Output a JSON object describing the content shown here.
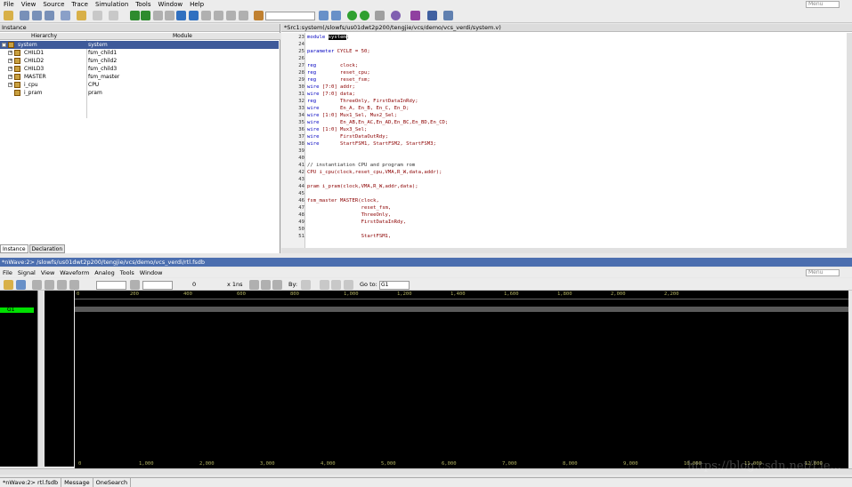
{
  "menubar": {
    "items": [
      "File",
      "View",
      "Source",
      "Trace",
      "Simulation",
      "Tools",
      "Window",
      "Help"
    ],
    "search_placeholder": "Menu"
  },
  "instance_panel": {
    "title": "Instance",
    "columns": [
      "Hierarchy",
      "Module"
    ],
    "rows": [
      {
        "name": "system",
        "module": "system",
        "selected": true
      },
      {
        "name": "CHILD1",
        "module": "fsm_child1"
      },
      {
        "name": "CHILD2",
        "module": "fsm_child2"
      },
      {
        "name": "CHILD3",
        "module": "fsm_child3"
      },
      {
        "name": "MASTER",
        "module": "fsm_master"
      },
      {
        "name": "i_cpu",
        "module": "CPU"
      },
      {
        "name": "i_pram",
        "module": "pram"
      }
    ],
    "tabs": [
      "Instance",
      "Declaration"
    ]
  },
  "source_panel": {
    "title": "*Src1:system(/slowfs/us01dwt2p200/tengjie/vcs/demo/vcs_verdi/system.v)",
    "lines": [
      {
        "n": "23",
        "t": "module system;"
      },
      {
        "n": "24",
        "t": ""
      },
      {
        "n": "25",
        "t": "parameter CYCLE = 50;"
      },
      {
        "n": "26",
        "t": ""
      },
      {
        "n": "27",
        "t": "reg        clock;"
      },
      {
        "n": "28",
        "t": "reg        reset_cpu;"
      },
      {
        "n": "29",
        "t": "reg        reset_fsm;"
      },
      {
        "n": "30",
        "t": "wire [7:0] addr;"
      },
      {
        "n": "31",
        "t": "wire [7:0] data;"
      },
      {
        "n": "32",
        "t": "reg        ThreeOnly, FirstDataInRdy;"
      },
      {
        "n": "33",
        "t": "wire       En_A, En_B, En_C, En_D;"
      },
      {
        "n": "34",
        "t": "wire [1:0] Mux1_Sel, Mux2_Sel;"
      },
      {
        "n": "35",
        "t": "wire       En_AB,En_AC,En_AD,En_BC,En_BD,En_CD;"
      },
      {
        "n": "36",
        "t": "wire [1:0] Mux3_Sel;"
      },
      {
        "n": "37",
        "t": "wire       FirstDataOutRdy;"
      },
      {
        "n": "38",
        "t": "wire       StartFSM1, StartFSM2, StartFSM3;"
      },
      {
        "n": "39",
        "t": ""
      },
      {
        "n": "40",
        "t": ""
      },
      {
        "n": "41",
        "t": "// instantiation CPU and program rom"
      },
      {
        "n": "42",
        "t": "CPU i_cpu(clock,reset_cpu,VMA,R_W,data,addr);"
      },
      {
        "n": "43",
        "t": ""
      },
      {
        "n": "44",
        "t": "pram i_pram(clock,VMA,R_W,addr,data);"
      },
      {
        "n": "45",
        "t": ""
      },
      {
        "n": "46",
        "t": "fsm_master MASTER(clock,"
      },
      {
        "n": "47",
        "t": "                  reset_fsm,"
      },
      {
        "n": "48",
        "t": "                  ThreeOnly,"
      },
      {
        "n": "49",
        "t": "                  FirstDataInRdy,"
      },
      {
        "n": "50",
        "t": ""
      },
      {
        "n": "51",
        "t": "                  StartFSM1,"
      }
    ]
  },
  "nwave": {
    "title": "*nWave:2> /slowfs/us01dwt2p200/tengjie/vcs/demo/vcs_verdi/rtl.fsdb",
    "menu": [
      "File",
      "Signal",
      "View",
      "Waveform",
      "Analog",
      "Tools",
      "Window"
    ],
    "search_placeholder": "Menu",
    "cursor_value": "0",
    "time_unit": "x 1ns",
    "by_label": "By:",
    "goto_label": "Go to:",
    "goto_value": "G1",
    "group_name": "G1",
    "ruler_top": [
      "0",
      "200",
      "400",
      "600",
      "800",
      "1,000",
      "1,200",
      "1,400",
      "1,600",
      "1,800",
      "2,000",
      "2,200"
    ],
    "ruler_bottom": [
      "0",
      "1,000",
      "2,000",
      "3,000",
      "4,000",
      "5,000",
      "6,000",
      "7,000",
      "8,000",
      "9,000",
      "10,000",
      "11,000",
      "12,000"
    ]
  },
  "statusbar": {
    "items": [
      "*nWave:2> rtl.fsdb",
      "Message",
      "OneSearch"
    ]
  },
  "watermark": "https://blog.csdn.net/Lie..."
}
